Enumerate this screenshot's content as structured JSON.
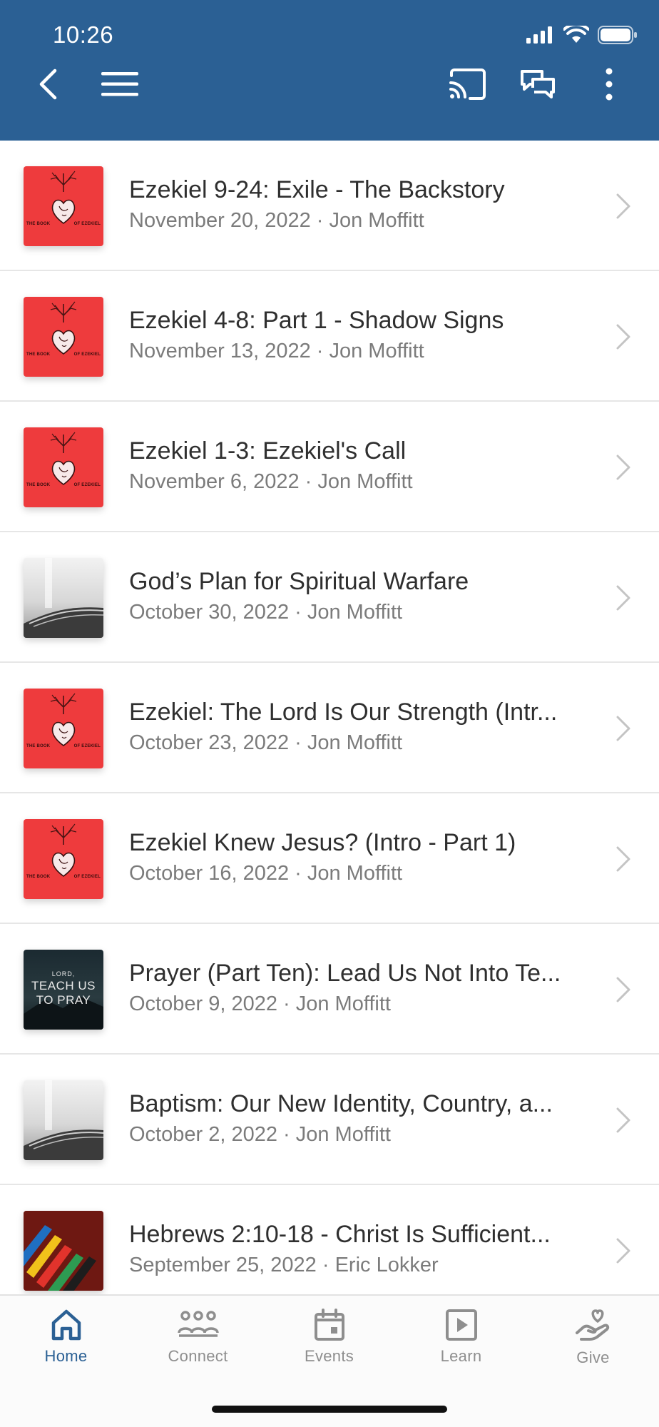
{
  "status_bar": {
    "time": "10:26"
  },
  "header": {
    "icons": [
      "back-icon",
      "menu-icon",
      "cast-icon",
      "chat-icon",
      "more-icon"
    ]
  },
  "sermons": [
    {
      "title": "Ezekiel 9-24: Exile - The Backstory",
      "date": "November 20, 2022",
      "speaker": "Jon Moffitt",
      "meta": "November 20, 2022 · Jon Moffitt",
      "thumb": "ezekiel"
    },
    {
      "title": "Ezekiel 4-8: Part 1 - Shadow Signs",
      "date": "November 13, 2022",
      "speaker": "Jon Moffitt",
      "meta": "November 13, 2022 · Jon Moffitt",
      "thumb": "ezekiel"
    },
    {
      "title": "Ezekiel 1-3: Ezekiel's Call",
      "date": "November 6, 2022",
      "speaker": "Jon Moffitt",
      "meta": "November 6, 2022 · Jon Moffitt",
      "thumb": "ezekiel"
    },
    {
      "title": "God’s Plan for Spiritual Warfare",
      "date": "October 30, 2022",
      "speaker": "Jon Moffitt",
      "meta": "October 30, 2022 · Jon Moffitt",
      "thumb": "bible"
    },
    {
      "title": "Ezekiel: The Lord Is Our Strength (Intr...",
      "date": "October 23, 2022",
      "speaker": "Jon Moffitt",
      "meta": "October 23, 2022 · Jon Moffitt",
      "thumb": "ezekiel"
    },
    {
      "title": "Ezekiel Knew Jesus? (Intro - Part 1)",
      "date": "October 16, 2022",
      "speaker": "Jon Moffitt",
      "meta": "October 16, 2022 · Jon Moffitt",
      "thumb": "ezekiel"
    },
    {
      "title": "Prayer (Part Ten): Lead Us Not Into Te...",
      "date": "October 9, 2022",
      "speaker": "Jon Moffitt",
      "meta": "October 9, 2022 · Jon Moffitt",
      "thumb": "pray"
    },
    {
      "title": "Baptism: Our New Identity, Country, a...",
      "date": "October 2, 2022",
      "speaker": "Jon Moffitt",
      "meta": "October 2, 2022 · Jon Moffitt",
      "thumb": "bible"
    },
    {
      "title": "Hebrews 2:10-18 - Christ Is Sufficient...",
      "date": "September 25, 2022",
      "speaker": "Eric Lokker",
      "meta": "September 25, 2022 · Eric Lokker",
      "thumb": "hebrews"
    }
  ],
  "thumb_text": {
    "ezekiel_left": "THE BOOK",
    "ezekiel_right": "OF EZEKIEL",
    "pray_small": "LORD,",
    "pray_line1": "TEACH US",
    "pray_line2": "TO PRAY"
  },
  "tabbar": {
    "tabs": [
      {
        "label": "Home",
        "icon": "home-icon",
        "active": true
      },
      {
        "label": "Connect",
        "icon": "people-icon",
        "active": false
      },
      {
        "label": "Events",
        "icon": "calendar-icon",
        "active": false
      },
      {
        "label": "Learn",
        "icon": "play-icon",
        "active": false
      },
      {
        "label": "Give",
        "icon": "give-icon",
        "active": false
      }
    ]
  },
  "colors": {
    "header_bg": "#2b6094",
    "accent": "#2b6094",
    "inactive_tab": "#8e8e8e",
    "ezekiel_red": "#ee3b3d"
  }
}
